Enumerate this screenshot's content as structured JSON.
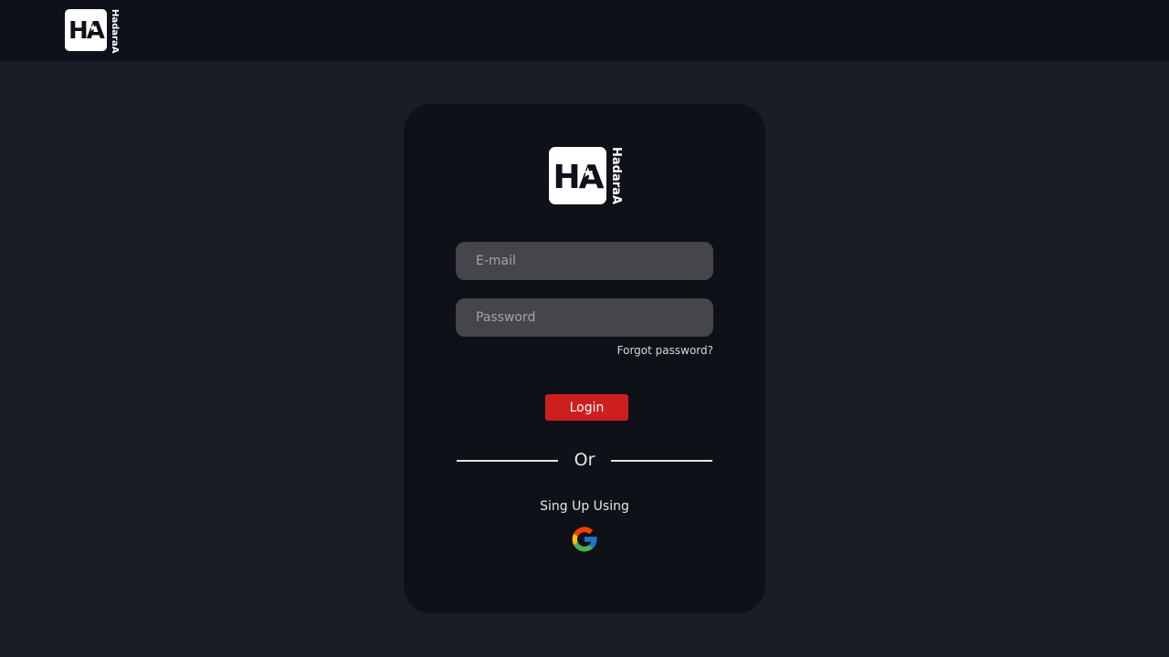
{
  "header": {
    "logo": {
      "mark": "HA",
      "brand": "HadaraA"
    }
  },
  "login_card": {
    "logo": {
      "mark": "HA",
      "brand": "HadaraA"
    },
    "email_placeholder": "E-mail",
    "password_placeholder": "Password",
    "forgot_password": "Forgot password?",
    "login_button": "Login",
    "divider": "Or",
    "signup_text": "Sing Up Using",
    "google_icon": "google-icon"
  },
  "colors": {
    "page_background": "#1a1d26",
    "topbar_background": "#0e1119",
    "card_background": "#0f1118",
    "input_background": "#45464b",
    "accent": "#cd1f1f"
  }
}
